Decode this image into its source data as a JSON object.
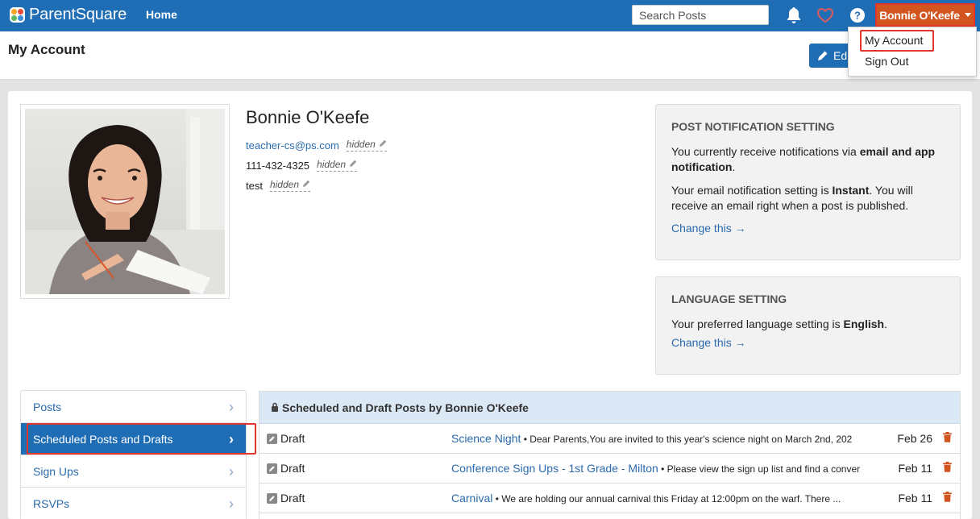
{
  "app": {
    "name": "ParentSquare"
  },
  "nav": {
    "home": "Home"
  },
  "search": {
    "placeholder": "Search Posts"
  },
  "user_menu": {
    "label": "Bonnie O'Keefe",
    "items": [
      "My Account",
      "Sign Out"
    ]
  },
  "page": {
    "title": "My Account",
    "edit_button": "Ed"
  },
  "profile": {
    "name": "Bonnie O'Keefe",
    "email": "teacher-cs@ps.com",
    "phone": "111-432-4325",
    "extra": "test",
    "hidden_label": "hidden"
  },
  "notification_setting": {
    "title": "POST NOTIFICATION SETTING",
    "line1_pre": "You currently receive notifications via ",
    "line1_bold": "email and app notification",
    "line1_post": ".",
    "line2_pre": "Your email notification setting is ",
    "line2_bold": "Instant",
    "line2_post": ". You will receive an email right when a post is published.",
    "link": "Change this →"
  },
  "language_setting": {
    "title": "LANGUAGE SETTING",
    "text_pre": "Your preferred language setting is ",
    "text_bold": "English",
    "text_post": ".",
    "link": "Change this →"
  },
  "side_menu": {
    "items": [
      "Posts",
      "Scheduled Posts and Drafts",
      "Sign Ups",
      "RSVPs"
    ],
    "active_index": 1
  },
  "posts_panel": {
    "title": "Scheduled and Draft Posts by Bonnie O'Keefe",
    "rows": [
      {
        "status": "Draft",
        "title": "Science Night",
        "excerpt": " • Dear Parents,You are invited to this year's science night on March 2nd, 202",
        "date": "Feb 26"
      },
      {
        "status": "Draft",
        "title": "Conference Sign Ups - 1st Grade - Milton",
        "excerpt": " • Please view the sign up list and find a conver",
        "date": "Feb 11"
      },
      {
        "status": "Draft",
        "title": "Carnival",
        "excerpt": " • We are holding our annual carnival this Friday at 12:00pm on the warf. There ...",
        "date": "Feb 11"
      }
    ]
  },
  "colors": {
    "brand": "#1e6db5",
    "accent": "#d2541e",
    "highlight": "#e3342f",
    "link": "#2a6aad"
  }
}
